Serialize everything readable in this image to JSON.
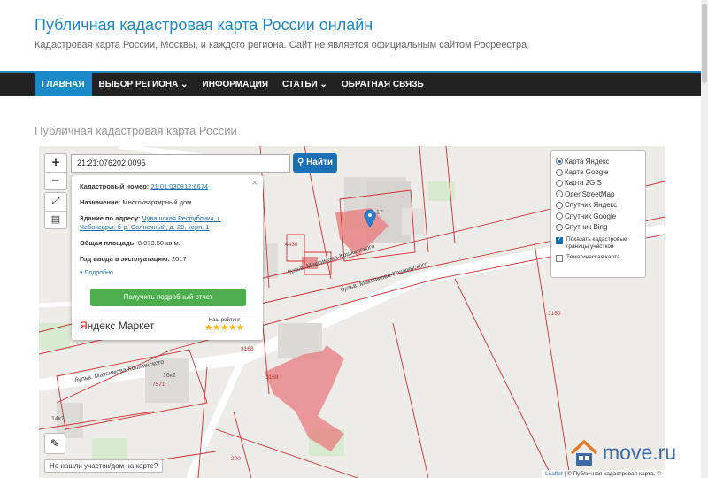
{
  "site": {
    "title": "Публичная кадастровая карта России онлайн",
    "tagline": "Кадастровая карта России, Москвы, и каждого региона. Сайт не является официальным сайтом Росреестра"
  },
  "nav": {
    "items": [
      {
        "label": "ГЛАВНАЯ",
        "active": true
      },
      {
        "label": "ВЫБОР РЕГИОНА ⌄",
        "active": false
      },
      {
        "label": "ИНФОРМАЦИЯ",
        "active": false
      },
      {
        "label": "СТАТЬИ ⌄",
        "active": false
      },
      {
        "label": "ОБРАТНАЯ СВЯЗЬ",
        "active": false
      }
    ]
  },
  "page": {
    "heading": "Публичная кадастровая карта России"
  },
  "map": {
    "zoom_in": "+",
    "zoom_out": "−",
    "search_value": "21:21:076202:0095",
    "search_button": "Найти",
    "popup": {
      "cadastral_label": "Кадастровый номер:",
      "cadastral_value": "21:01:030312:6674",
      "purpose_label": "Назначение:",
      "purpose_value": "Многоквартирный дом",
      "address_label": "Здание по адресу:",
      "address_value": "Чувашская Республика, г. Чебоксары, б-р. Солнечный, д. 20, корп. 1",
      "area_label": "Общая площадь:",
      "area_value": "8 073.50 кв.м.",
      "year_label": "Год ввода в эксплуатацию:",
      "year_value": "2017",
      "more_link": "▾ Подробно",
      "report_button": "Получить подробный отчет",
      "close": "×",
      "ym_logo_red": "Я",
      "ym_logo_rest": "ндекс Маркет",
      "ym_rating_label": "Наш рейтинг",
      "ym_stars": "★★★★★"
    },
    "layers": [
      {
        "label": "Карта Яндекс",
        "selected": true
      },
      {
        "label": "Карта Google",
        "selected": false
      },
      {
        "label": "Карта 2GIS",
        "selected": false
      },
      {
        "label": "OpenStreetMap",
        "selected": false
      },
      {
        "label": "Спутник Яндекс",
        "selected": false
      },
      {
        "label": "Спутник Google",
        "selected": false
      },
      {
        "label": "Спутник Bing",
        "selected": false
      }
    ],
    "checks": [
      {
        "label": "Показать кадастровые границы участков",
        "checked": true
      },
      {
        "label": "Тематическая карта",
        "checked": false
      }
    ],
    "not_found_button": "Не нашли участок/дом на карте?",
    "attribution_leaflet": "Leaflet",
    "attribution_rest": " | © Публичная кадастровая карта, ©",
    "labels": {
      "n4430": "4430",
      "n3150": "3150",
      "n3168a": "3168",
      "n3168b": "3168",
      "n7571": "7571",
      "n200": "200",
      "n16k2": "16к2",
      "n14k2": "14к2",
      "n17": "17",
      "street1": "бульв. Максимова-Кошкинского",
      "street2": "бульв. Максимова-Кошкинского",
      "street3": "бульв. Максимова-Кошкинского"
    }
  },
  "watermark": {
    "text": "move.ru"
  },
  "colors": {
    "accent": "#1a8ac6",
    "navbar": "#222222",
    "cadastre_line": "#cc3333",
    "button_green": "#4cae4c"
  }
}
